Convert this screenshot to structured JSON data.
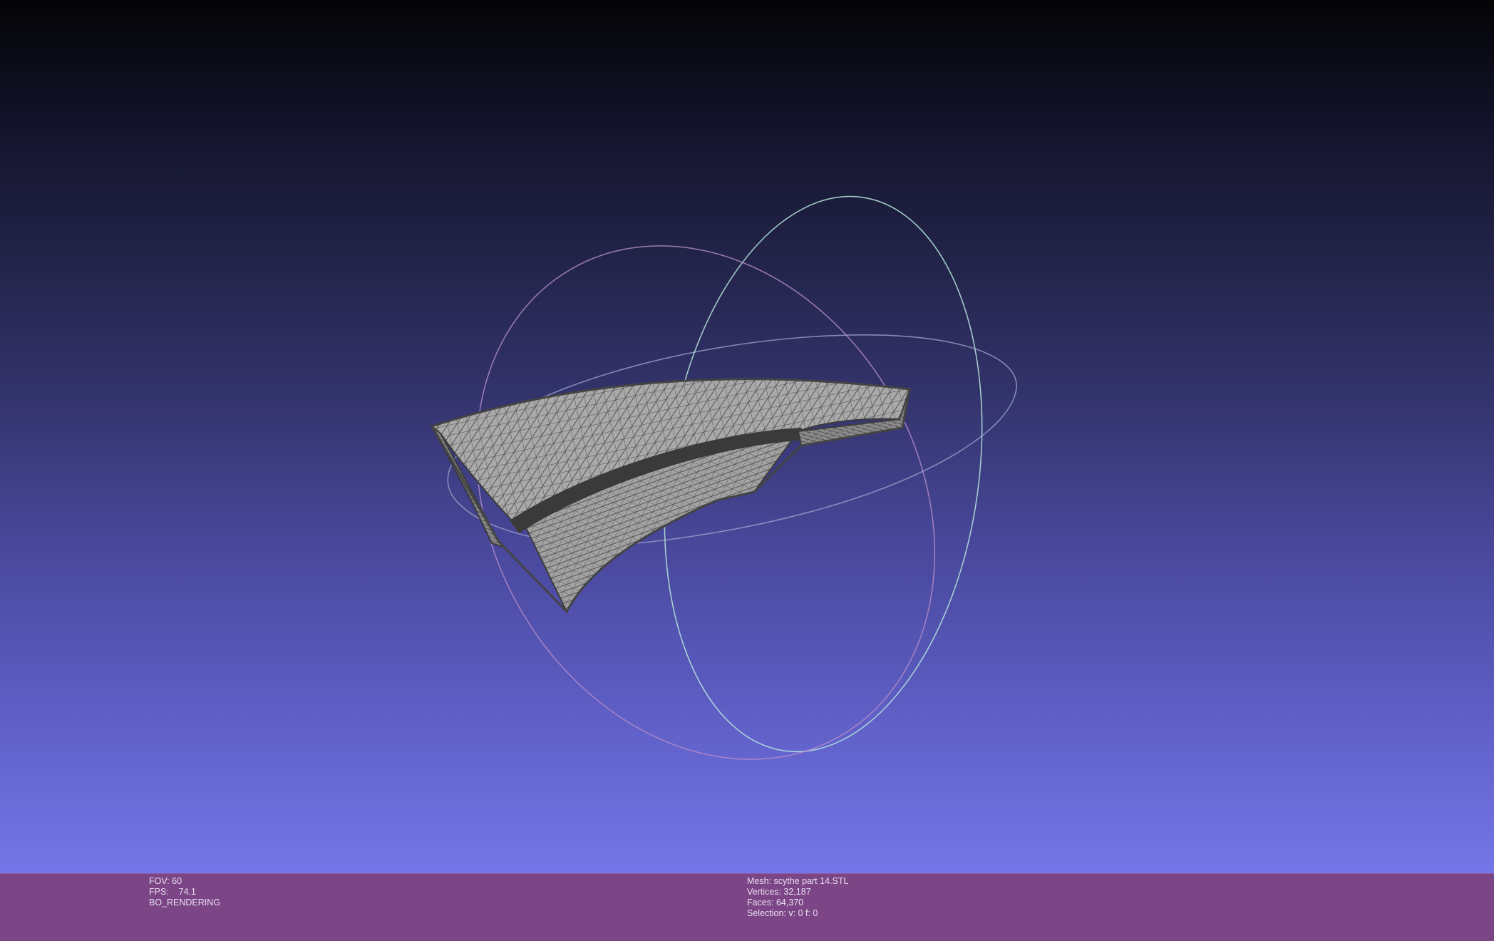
{
  "viewer": {
    "background_top": "#040406",
    "background_bottom": "#7576e8",
    "info_bar_color": "#7c4686",
    "mesh_fill_color": "#a9a9a9",
    "mesh_wire_color": "#4a4a4a",
    "trackball_colors": [
      "#b48cc8",
      "#9aa0c8",
      "#b6e6dc"
    ]
  },
  "info": {
    "left": {
      "fov": "FOV: 60",
      "fps": "FPS:    74.1",
      "mode": "BO_RENDERING"
    },
    "right": {
      "mesh": "Mesh: scythe part 14.STL",
      "vertices": "Vertices: 32,187",
      "faces": "Faces: 64,370",
      "selection": "Selection: v: 0 f: 0"
    }
  }
}
